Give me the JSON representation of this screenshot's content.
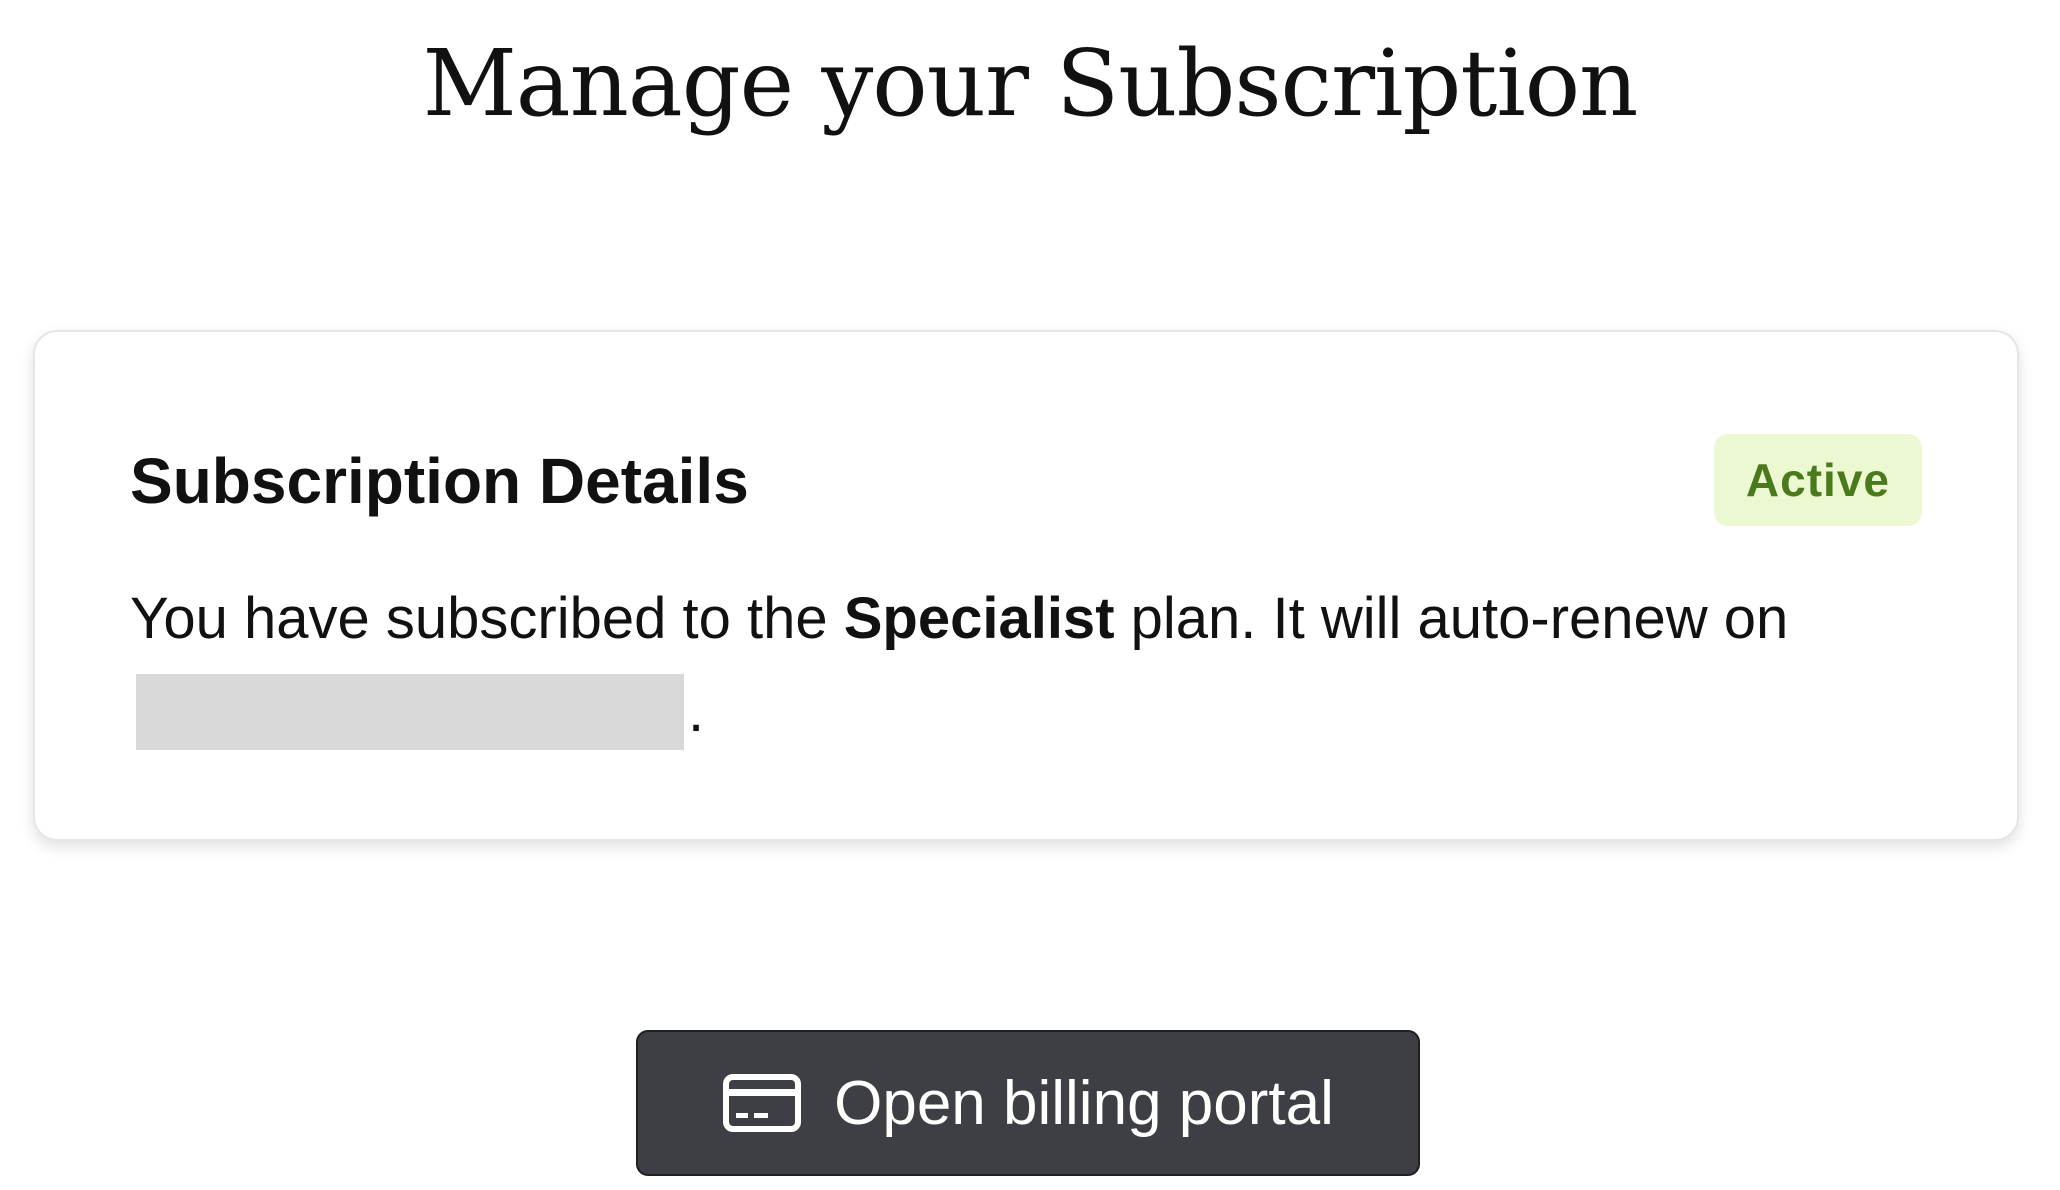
{
  "page": {
    "title": "Manage your Subscription"
  },
  "subscription_card": {
    "title": "Subscription Details",
    "status": "Active",
    "text_prefix": "You have subscribed to the ",
    "plan_name": "Specialist",
    "text_suffix": " plan. It will auto-renew on ",
    "renewal_date_redacted": true,
    "text_end": "."
  },
  "billing_button": {
    "label": "Open billing portal",
    "icon": "credit-card-icon"
  },
  "colors": {
    "badge_bg": "#ecf8d2",
    "badge_text": "#4a7a1c",
    "button_bg": "#3e3f44",
    "redaction": "#d9d9d9"
  }
}
